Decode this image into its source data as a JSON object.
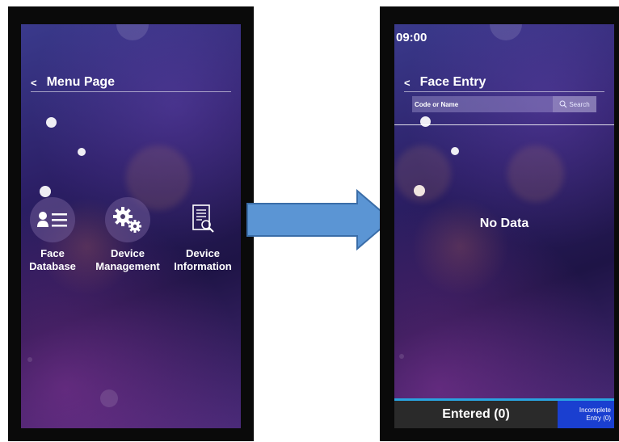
{
  "colors": {
    "accent_bar": "#29a3df",
    "incomplete_tab": "#1a3fd0",
    "entered_tab": "#2a2a2a",
    "arrow_fill": "#5b95d4",
    "arrow_stroke": "#3a6da8"
  },
  "menu_page": {
    "back_icon": "<",
    "title": "Menu Page",
    "items": [
      {
        "icon": "id-card-icon",
        "label": "Face\nDatabase"
      },
      {
        "icon": "gears-icon",
        "label": "Device\nManagement"
      },
      {
        "icon": "document-search-icon",
        "label": "Device\nInformation"
      }
    ]
  },
  "transition_arrow": {
    "icon": "right-arrow-icon"
  },
  "face_entry_page": {
    "clock": "09:00",
    "back_icon": "<",
    "title": "Face Entry",
    "search": {
      "placeholder": "Code or Name",
      "button_label": "Search"
    },
    "empty_message": "No Data",
    "tabs": {
      "entered": "Entered (0)",
      "incomplete": "Incomplete\nEntry (0)"
    }
  }
}
